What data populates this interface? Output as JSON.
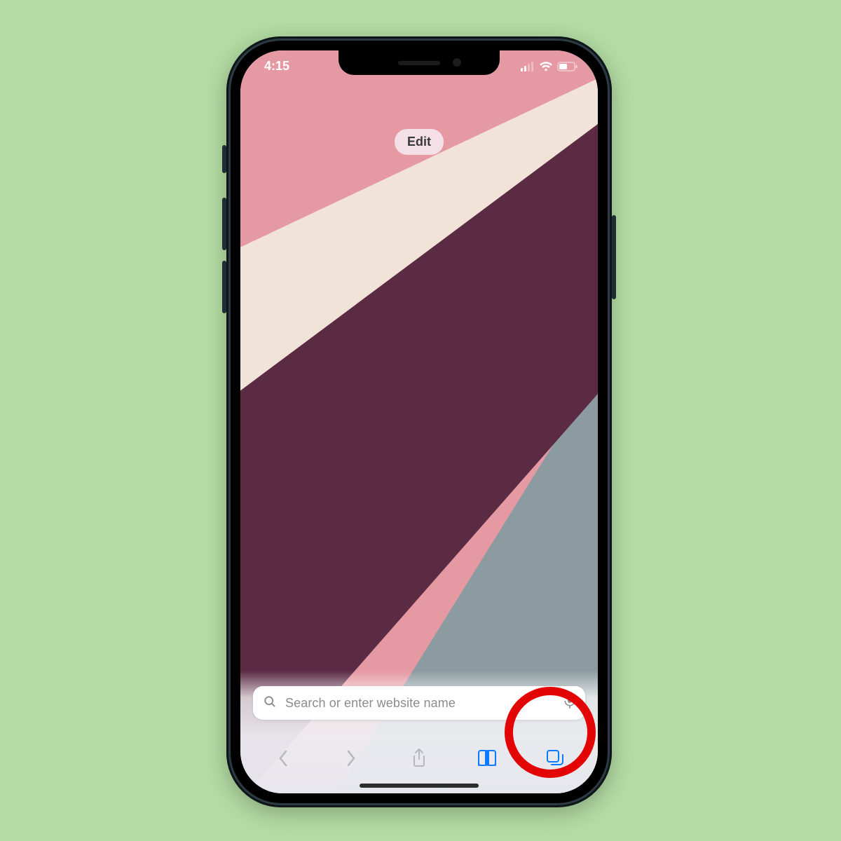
{
  "status": {
    "time": "4:15"
  },
  "start_page": {
    "edit_label": "Edit"
  },
  "search": {
    "placeholder": "Search or enter website name"
  },
  "toolbar": {
    "back": "Back",
    "forward": "Forward",
    "share": "Share",
    "bookmarks": "Bookmarks",
    "tabs": "Tabs"
  },
  "annotation": {
    "highlight_target": "tabs-button"
  },
  "colors": {
    "page_bg": "#b3dba3",
    "accent_blue": "#0a7bff",
    "callout_red": "#e30505",
    "wallpaper_pink": "#e59aa3",
    "wallpaper_cream": "#f1e3d8",
    "wallpaper_plum": "#5b2b44",
    "wallpaper_slate": "#8b9ba0"
  }
}
